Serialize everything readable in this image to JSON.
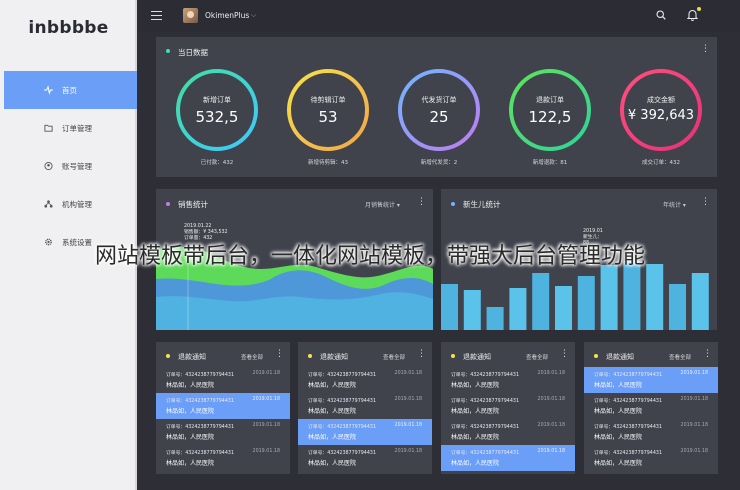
{
  "app": {
    "logo": "inbbbbe"
  },
  "sidebar": {
    "items": [
      {
        "label": "首页",
        "icon": "pulse-icon",
        "active": true
      },
      {
        "label": "订单管理",
        "icon": "folder-icon",
        "active": false
      },
      {
        "label": "账号管理",
        "icon": "user-circle-icon",
        "active": false
      },
      {
        "label": "机构管理",
        "icon": "org-icon",
        "active": false
      },
      {
        "label": "系统设置",
        "icon": "gear-icon",
        "active": false
      }
    ]
  },
  "topbar": {
    "username": "OkimenPlus",
    "caret": "⌵"
  },
  "summary": {
    "title": "当日数据",
    "gauges": [
      {
        "label": "新增订单",
        "value": "532,5",
        "sub": "已付款：432",
        "colors": [
          "#40e0a0",
          "#3ec8ff"
        ]
      },
      {
        "label": "待剪辑订单",
        "value": "53",
        "sub": "新增待剪辑：43",
        "colors": [
          "#f6e24a",
          "#f2a54a"
        ]
      },
      {
        "label": "代发货订单",
        "value": "25",
        "sub": "新增代发货：2",
        "colors": [
          "#6fb6ff",
          "#c07cf0"
        ]
      },
      {
        "label": "退款订单",
        "value": "122,5",
        "sub": "新增退款：81",
        "colors": [
          "#5fe35a",
          "#2fd39a"
        ]
      },
      {
        "label": "成交金额",
        "value": "¥ 392,643",
        "sub": "成交订单：432",
        "colors": [
          "#ff4f7d",
          "#e9317a"
        ]
      }
    ]
  },
  "sales": {
    "title": "销售统计",
    "select": "月销售统计",
    "tooltip": {
      "date": "2019.01.22",
      "line1": "销售额：¥ 343,532",
      "line2": "订单量：432"
    }
  },
  "births": {
    "title": "新生儿统计",
    "select": "年统计",
    "tooltip": {
      "date": "2019.01",
      "line1": "新生儿：",
      "line2": "88"
    },
    "bar_colors": [
      "#4fb3e0",
      "#5bc2ea"
    ]
  },
  "lists": [
    {
      "title": "退款通知",
      "more": "查看全部",
      "dot": "#f6e24a",
      "highlight": 1,
      "rows": [
        {
          "order": "订单号：432423877979443​1",
          "date": "2019.01.18",
          "name": "林品如，人民医院"
        },
        {
          "order": "订单号：4324238779794431",
          "date": "2019.01.18",
          "name": "林品如，人民医院"
        },
        {
          "order": "订单号：4324238779794431",
          "date": "2019.01.18",
          "name": "林品如，人民医院"
        },
        {
          "order": "订单号：4324238779794431",
          "date": "2019.01.18",
          "name": "林品如，人民医院"
        }
      ]
    },
    {
      "title": "退款通知",
      "more": "查看全部",
      "dot": "#f6e24a",
      "highlight": 2,
      "rows": [
        {
          "order": "订单号：4324238779794431",
          "date": "2019.01.18",
          "name": "林品如，人民医院"
        },
        {
          "order": "订单号：4324238779794431",
          "date": "2019.01.18",
          "name": "林品如，人民医院"
        },
        {
          "order": "订单号：4324238779794431",
          "date": "2019.01.18",
          "name": "林品如，人民医院"
        },
        {
          "order": "订单号：4324238779794431",
          "date": "2019.01.18",
          "name": "林品如，人民医院"
        }
      ]
    },
    {
      "title": "退款通知",
      "more": "查看全部",
      "dot": "#f6e24a",
      "highlight": 3,
      "rows": [
        {
          "order": "订单号：4324238779794431",
          "date": "2019.01.18",
          "name": "林品如，人民医院"
        },
        {
          "order": "订单号：4324238779794431",
          "date": "2019.01.18",
          "name": "林品如，人民医院"
        },
        {
          "order": "订单号：4324238779794431",
          "date": "2019.01.18",
          "name": "林品如，人民医院"
        },
        {
          "order": "订单号：4324238779794431",
          "date": "2019.01.18",
          "name": "林品如，人民医院"
        }
      ]
    },
    {
      "title": "退款通知",
      "more": "查看全部",
      "dot": "#f6e24a",
      "highlight": 0,
      "rows": [
        {
          "order": "订单号：4324238779794431",
          "date": "2019.01.18",
          "name": "林品如，人民医院"
        },
        {
          "order": "订单号：4324238779794431",
          "date": "2019.01.18",
          "name": "林品如，人民医院"
        },
        {
          "order": "订单号：4324238779794431",
          "date": "2019.01.18",
          "name": "林品如，人民医院"
        },
        {
          "order": "订单号：4324238779794431",
          "date": "2019.01.18",
          "name": "林品如，人民医院"
        }
      ]
    }
  ],
  "watermark": "网站模板带后台，一体化网站模板，带强大后台管理功能",
  "colors": {
    "accent": "#6b9ef7",
    "card": "#41434c",
    "background": "#2d2e36"
  }
}
